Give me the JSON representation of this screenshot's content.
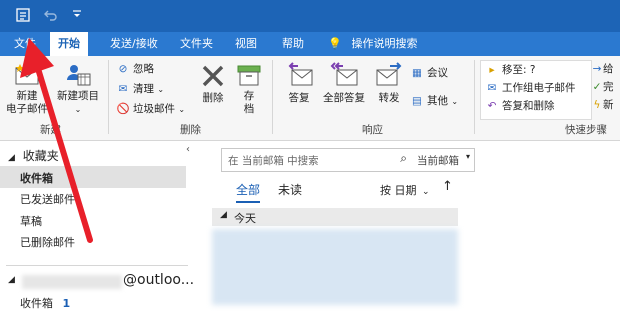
{
  "tabs": {
    "file": "文件",
    "home": "开始",
    "send_receive": "发送/接收",
    "folder": "文件夹",
    "view": "视图",
    "help": "帮助",
    "tell_me": "操作说明搜索"
  },
  "ribbon": {
    "new_email_line1": "新建",
    "new_email_line2": "电子邮件",
    "new_items": "新建项目",
    "group_new": "新建",
    "ignore": "忽略",
    "clean_up": "清理",
    "junk": "垃圾邮件",
    "delete": "删除",
    "archive_line1": "存",
    "archive_line2": "档",
    "group_delete": "删除",
    "reply": "答复",
    "reply_all": "全部答复",
    "forward": "转发",
    "meeting": "会议",
    "more": "其他",
    "group_respond": "响应",
    "qs_move": "移至: ?",
    "qs_team": "工作组电子邮件",
    "qs_reply_delete": "答复和删除",
    "qs_to_manager": "给",
    "qs_done": "完",
    "qs_new": "新",
    "group_quick_steps": "快速步骤"
  },
  "folders": {
    "favorites": "收藏夹",
    "inbox": "收件箱",
    "sent": "已发送邮件",
    "drafts": "草稿",
    "deleted": "已删除邮件",
    "account_suffix": "@outloo...",
    "account_inbox": "收件箱",
    "account_inbox_count": "1"
  },
  "search": {
    "placeholder": "在 当前邮箱 中搜索",
    "scope": "当前邮箱"
  },
  "msglist": {
    "filter_all": "全部",
    "filter_unread": "未读",
    "sort_label": "按 日期",
    "group_today": "今天"
  },
  "colors": {
    "titlebar": "#1d64b6",
    "tabbar": "#2b79d0",
    "accent": "#1a5fb4",
    "annotation_arrow": "#e8202a"
  }
}
